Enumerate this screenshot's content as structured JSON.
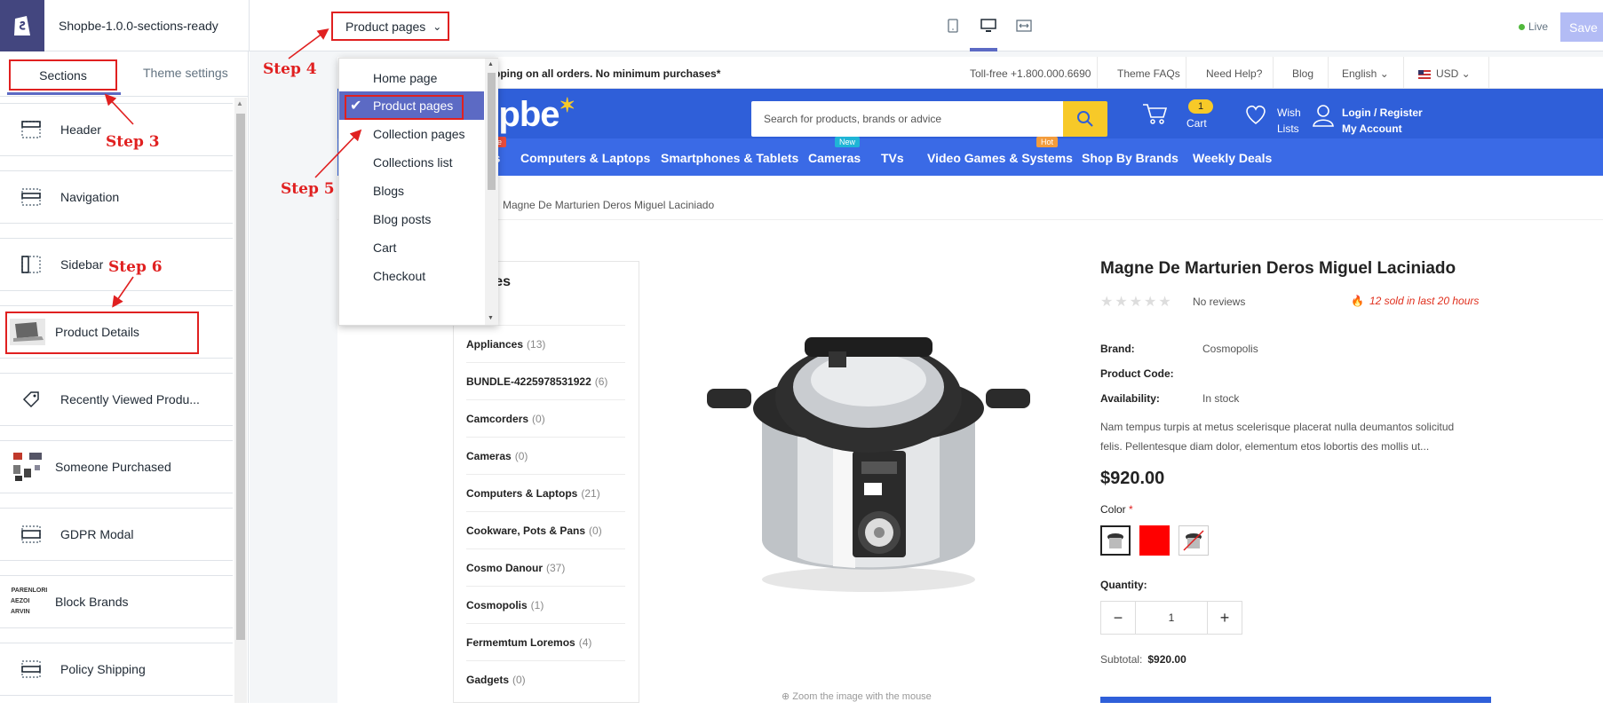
{
  "topbar": {
    "theme_title": "Shopbe-1.0.0-sections-ready",
    "page_select": "Product pages",
    "live_label": "Live",
    "save_label": "Save"
  },
  "sidebar": {
    "tab_sections": "Sections",
    "tab_theme": "Theme settings",
    "items": [
      {
        "label": "Header",
        "icon": "header-layout-icon"
      },
      {
        "label": "Navigation",
        "icon": "navigation-layout-icon"
      },
      {
        "label": "Sidebar",
        "icon": "sidebar-layout-icon"
      },
      {
        "label": "Product Details",
        "icon": "laptop-thumbnail-icon"
      },
      {
        "label": "Recently Viewed Produ...",
        "icon": "tag-icon"
      },
      {
        "label": "Someone Purchased",
        "icon": "products-thumbnail-icon"
      },
      {
        "label": "GDPR Modal",
        "icon": "modal-layout-icon"
      },
      {
        "label": "Block Brands",
        "icon": "brands-thumbnail-icon"
      },
      {
        "label": "Policy Shipping",
        "icon": "policy-layout-icon"
      }
    ],
    "brands_thumb_line1": "PARENLORI",
    "brands_thumb_line2": "AEZOI ARVIN"
  },
  "dropdown": {
    "items": [
      "Home page",
      "Product pages",
      "Collection pages",
      "Collections list",
      "Blogs",
      "Blog posts",
      "Cart",
      "Checkout"
    ],
    "selected": "Product pages"
  },
  "steps": {
    "step3": "Step 3",
    "step4": "Step 4",
    "step5": "Step 5",
    "step6": "Step 6"
  },
  "store": {
    "announcement": "pping on all orders. No minimum purchases*",
    "tollfree": "Toll-free +1.800.000.6690",
    "faq": "Theme FAQs",
    "help": "Need Help?",
    "blog": "Blog",
    "language": "English",
    "currency": "USD",
    "brand_partial": "opbe",
    "search_placeholder": "Search for products, brands or advice",
    "cart_count": "1",
    "cart_label": "Cart",
    "wish_line1": "Wish",
    "wish_line2": "Lists",
    "account_line1": "Login / Register",
    "account_line2": "My Account",
    "nav": [
      {
        "label": "ces",
        "badge": "Sale"
      },
      {
        "label": "Computers & Laptops"
      },
      {
        "label": "Smartphones & Tablets"
      },
      {
        "label": "Cameras",
        "badge": "New"
      },
      {
        "label": "TVs"
      },
      {
        "label": "Video Games & Systems",
        "badge": "Hot"
      },
      {
        "label": "Shop By Brands"
      },
      {
        "label": "Weekly Deals"
      }
    ],
    "badge_colors": {
      "Sale": "#e74c3c",
      "New": "#1fb5d6",
      "Hot": "#f39c3c"
    },
    "breadcrumb": "Magne De Marturien Deros Miguel Laciniado",
    "categories_title": "gories",
    "categories": [
      {
        "name": "",
        "count": ")"
      },
      {
        "name": "Appliances",
        "count": "(13)"
      },
      {
        "name": "BUNDLE-4225978531922",
        "count": "(6)"
      },
      {
        "name": "Camcorders",
        "count": "(0)"
      },
      {
        "name": "Cameras",
        "count": "(0)"
      },
      {
        "name": "Computers & Laptops",
        "count": "(21)"
      },
      {
        "name": "Cookware, Pots & Pans",
        "count": "(0)"
      },
      {
        "name": "Cosmo Danour",
        "count": "(37)"
      },
      {
        "name": "Cosmopolis",
        "count": "(1)"
      },
      {
        "name": "Fermemtum Loremos",
        "count": "(4)"
      },
      {
        "name": "Gadgets",
        "count": "(0)"
      }
    ],
    "zoom_note": "Zoom the image with the mouse",
    "product": {
      "title": "Magne De Marturien Deros Miguel Laciniado",
      "reviews": "No reviews",
      "sold": "12 sold in last 20 hours",
      "brand_label": "Brand:",
      "brand": "Cosmopolis",
      "code_label": "Product Code:",
      "avail_label": "Availability:",
      "availability": "In stock",
      "description": "Nam tempus turpis at metus scelerisque placerat nulla deumantos solicitud felis. Pellentesque diam dolor, elementum etos lobortis des mollis ut...",
      "price": "$920.00",
      "color_label": "Color",
      "color_required": "*",
      "qty_label": "Quantity:",
      "qty": "1",
      "subtotal_label": "Subtotal:",
      "subtotal": "$920.00",
      "rating": 0
    }
  }
}
